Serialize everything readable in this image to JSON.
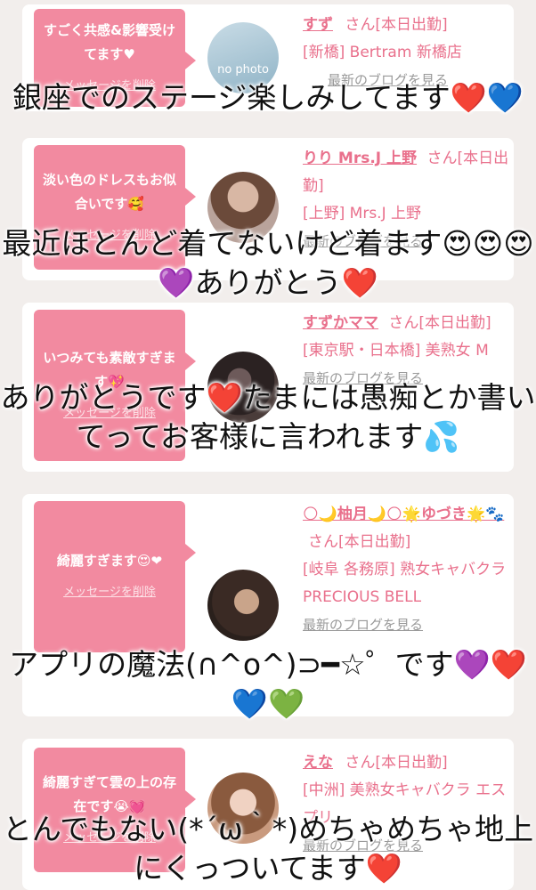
{
  "cards": [
    {
      "bubble_text": "すごく共感&影響受けてます♥",
      "delete_label": "メッセージを削除",
      "avatar_text": "no photo",
      "name": "すず",
      "suffix": "さん[本日出勤]",
      "shop": "[新橋] Bertram 新橋店",
      "blog_label": "最新のブログを見る"
    },
    {
      "bubble_text": "淡い色のドレスもお似合いです🥰",
      "delete_label": "メッセージを削除",
      "name": "りり Mrs.J 上野",
      "suffix": "さん[本日出勤]",
      "shop": "[上野] Mrs.J 上野",
      "blog_label": "最新のブログを見る"
    },
    {
      "bubble_text": "いつみても素敵すぎます💖",
      "delete_label": "メッセージを削除",
      "name": "すずかママ",
      "suffix": "さん[本日出勤]",
      "shop": "[東京駅・日本橋] 美熟女 M",
      "blog_label": "最新のブログを見る"
    },
    {
      "bubble_text": "綺麗すぎます😍❤",
      "delete_label": "メッセージを削除",
      "name": "🌕🌙柚月🌙🌕🌟ゆづき🌟🐾",
      "suffix": "さん[本日出勤]",
      "shop": "[岐阜 各務原] 熟女キャバクラ PRECIOUS BELL",
      "blog_label": "最新のブログを見る"
    },
    {
      "bubble_text": "綺麗すぎて雲の上の存在です😭💓",
      "delete_label": "メッセージを削除",
      "name": "えな",
      "suffix": "さん[本日出勤]",
      "shop": "[中洲] 美熟女キャバクラ エスプリ",
      "blog_label": "最新のブログを見る"
    }
  ],
  "overlays": [
    "銀座でのステージ楽しみしてます❤️💙",
    "最近ほとんど着てないけど着ます😍😍😍💜ありがとう❤️",
    "ありがとうです❤️たまには愚痴とか書いてってお客様に言われます💦",
    "アプリの魔法(∩^o^)⊃━☆゜です💜❤️💙💚",
    "とんでもない(*´ω｀*)めちゃめちゃ地上にくっついてます❤️"
  ],
  "colors": {
    "bubble": "#f28aa0",
    "accent": "#e9708c",
    "background": "#f2eeec"
  }
}
